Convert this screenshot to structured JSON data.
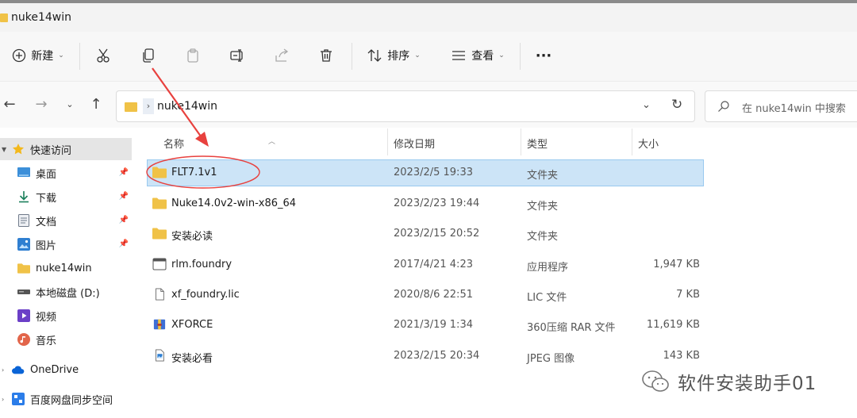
{
  "window": {
    "title": "nuke14win"
  },
  "toolbar": {
    "new_label": "新建",
    "sort_label": "排序",
    "view_label": "查看",
    "more_label": "···"
  },
  "address": {
    "path": "nuke14win"
  },
  "search": {
    "placeholder": "在 nuke14win 中搜索"
  },
  "sidebar": {
    "quick_access": "快速访问",
    "items": [
      {
        "label": "桌面",
        "pinned": true,
        "icon": "desktop-icon"
      },
      {
        "label": "下载",
        "pinned": true,
        "icon": "download-icon"
      },
      {
        "label": "文档",
        "pinned": true,
        "icon": "document-icon"
      },
      {
        "label": "图片",
        "pinned": true,
        "icon": "picture-icon"
      },
      {
        "label": "nuke14win",
        "pinned": false,
        "icon": "folder-icon"
      },
      {
        "label": "本地磁盘 (D:)",
        "pinned": false,
        "icon": "drive-icon"
      },
      {
        "label": "视频",
        "pinned": false,
        "icon": "video-icon"
      },
      {
        "label": "音乐",
        "pinned": false,
        "icon": "music-icon"
      }
    ],
    "onedrive": "OneDrive",
    "baidu": "百度网盘同步空间"
  },
  "columns": {
    "name": "名称",
    "date": "修改日期",
    "type": "类型",
    "size": "大小"
  },
  "files": [
    {
      "name": "FLT7.1v1",
      "date": "2023/2/5 19:33",
      "type": "文件夹",
      "size": "",
      "icon": "folder-icon"
    },
    {
      "name": "Nuke14.0v2-win-x86_64",
      "date": "2023/2/23 19:44",
      "type": "文件夹",
      "size": "",
      "icon": "folder-icon"
    },
    {
      "name": "安装必读",
      "date": "2023/2/15 20:52",
      "type": "文件夹",
      "size": "",
      "icon": "folder-icon"
    },
    {
      "name": "rlm.foundry",
      "date": "2017/4/21 4:23",
      "type": "应用程序",
      "size": "1,947 KB",
      "icon": "app-icon"
    },
    {
      "name": "xf_foundry.lic",
      "date": "2020/8/6 22:51",
      "type": "LIC 文件",
      "size": "7 KB",
      "icon": "file-icon"
    },
    {
      "name": "XFORCE",
      "date": "2021/3/19 1:34",
      "type": "360压缩 RAR 文件",
      "size": "11,619 KB",
      "icon": "archive-icon"
    },
    {
      "name": "安装必看",
      "date": "2023/2/15 20:34",
      "type": "JPEG 图像",
      "size": "143 KB",
      "icon": "image-icon"
    }
  ],
  "watermark": {
    "text": "软件安装助手01"
  },
  "colors": {
    "selection": "#cce4f7",
    "folder": "#f0c247",
    "annotation": "#e8413e",
    "accent": "#0067c0"
  }
}
